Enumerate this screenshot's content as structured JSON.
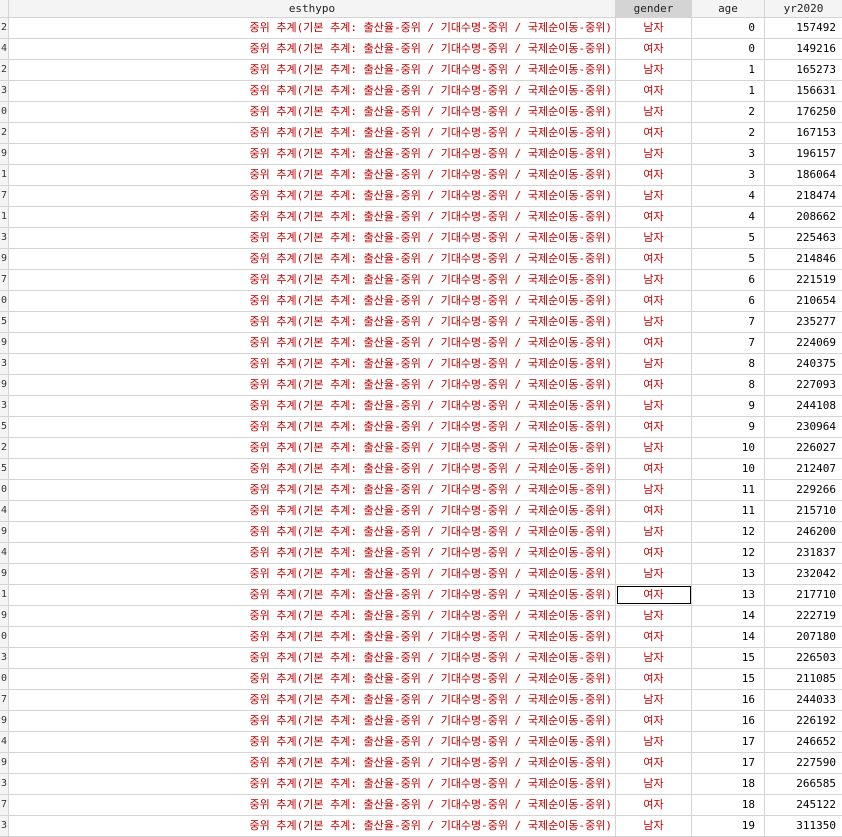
{
  "columns": {
    "esthypo": "esthypo",
    "gender": "gender",
    "age": "age",
    "yr2020": "yr2020"
  },
  "esthypo_value": "중위 추계(기본 추계: 출산율-중위 / 기대수명-중위 / 국제순이동-중위)",
  "selected_cell": {
    "row": 27,
    "column": "gender"
  },
  "rows": [
    {
      "rn": "2",
      "gender": "남자",
      "age": "0",
      "yr2020": "157492"
    },
    {
      "rn": "4",
      "gender": "여자",
      "age": "0",
      "yr2020": "149216"
    },
    {
      "rn": "2",
      "gender": "남자",
      "age": "1",
      "yr2020": "165273"
    },
    {
      "rn": "3",
      "gender": "여자",
      "age": "1",
      "yr2020": "156631"
    },
    {
      "rn": "0",
      "gender": "남자",
      "age": "2",
      "yr2020": "176250"
    },
    {
      "rn": "2",
      "gender": "여자",
      "age": "2",
      "yr2020": "167153"
    },
    {
      "rn": "9",
      "gender": "남자",
      "age": "3",
      "yr2020": "196157"
    },
    {
      "rn": "1",
      "gender": "여자",
      "age": "3",
      "yr2020": "186064"
    },
    {
      "rn": "7",
      "gender": "남자",
      "age": "4",
      "yr2020": "218474"
    },
    {
      "rn": "1",
      "gender": "여자",
      "age": "4",
      "yr2020": "208662"
    },
    {
      "rn": "3",
      "gender": "남자",
      "age": "5",
      "yr2020": "225463"
    },
    {
      "rn": "9",
      "gender": "여자",
      "age": "5",
      "yr2020": "214846"
    },
    {
      "rn": "7",
      "gender": "남자",
      "age": "6",
      "yr2020": "221519"
    },
    {
      "rn": "0",
      "gender": "여자",
      "age": "6",
      "yr2020": "210654"
    },
    {
      "rn": "5",
      "gender": "남자",
      "age": "7",
      "yr2020": "235277"
    },
    {
      "rn": "9",
      "gender": "여자",
      "age": "7",
      "yr2020": "224069"
    },
    {
      "rn": "3",
      "gender": "남자",
      "age": "8",
      "yr2020": "240375"
    },
    {
      "rn": "9",
      "gender": "여자",
      "age": "8",
      "yr2020": "227093"
    },
    {
      "rn": "3",
      "gender": "남자",
      "age": "9",
      "yr2020": "244108"
    },
    {
      "rn": "5",
      "gender": "여자",
      "age": "9",
      "yr2020": "230964"
    },
    {
      "rn": "2",
      "gender": "남자",
      "age": "10",
      "yr2020": "226027"
    },
    {
      "rn": "5",
      "gender": "여자",
      "age": "10",
      "yr2020": "212407"
    },
    {
      "rn": "0",
      "gender": "남자",
      "age": "11",
      "yr2020": "229266"
    },
    {
      "rn": "4",
      "gender": "여자",
      "age": "11",
      "yr2020": "215710"
    },
    {
      "rn": "9",
      "gender": "남자",
      "age": "12",
      "yr2020": "246200"
    },
    {
      "rn": "4",
      "gender": "여자",
      "age": "12",
      "yr2020": "231837"
    },
    {
      "rn": "9",
      "gender": "남자",
      "age": "13",
      "yr2020": "232042"
    },
    {
      "rn": "1",
      "gender": "여자",
      "age": "13",
      "yr2020": "217710"
    },
    {
      "rn": "9",
      "gender": "남자",
      "age": "14",
      "yr2020": "222719"
    },
    {
      "rn": "0",
      "gender": "여자",
      "age": "14",
      "yr2020": "207180"
    },
    {
      "rn": "3",
      "gender": "남자",
      "age": "15",
      "yr2020": "226503"
    },
    {
      "rn": "0",
      "gender": "여자",
      "age": "15",
      "yr2020": "211085"
    },
    {
      "rn": "7",
      "gender": "남자",
      "age": "16",
      "yr2020": "244033"
    },
    {
      "rn": "9",
      "gender": "여자",
      "age": "16",
      "yr2020": "226192"
    },
    {
      "rn": "4",
      "gender": "남자",
      "age": "17",
      "yr2020": "246652"
    },
    {
      "rn": "9",
      "gender": "여자",
      "age": "17",
      "yr2020": "227590"
    },
    {
      "rn": "3",
      "gender": "남자",
      "age": "18",
      "yr2020": "266585"
    },
    {
      "rn": "7",
      "gender": "여자",
      "age": "18",
      "yr2020": "245122"
    },
    {
      "rn": "3",
      "gender": "남자",
      "age": "19",
      "yr2020": "311350"
    }
  ]
}
